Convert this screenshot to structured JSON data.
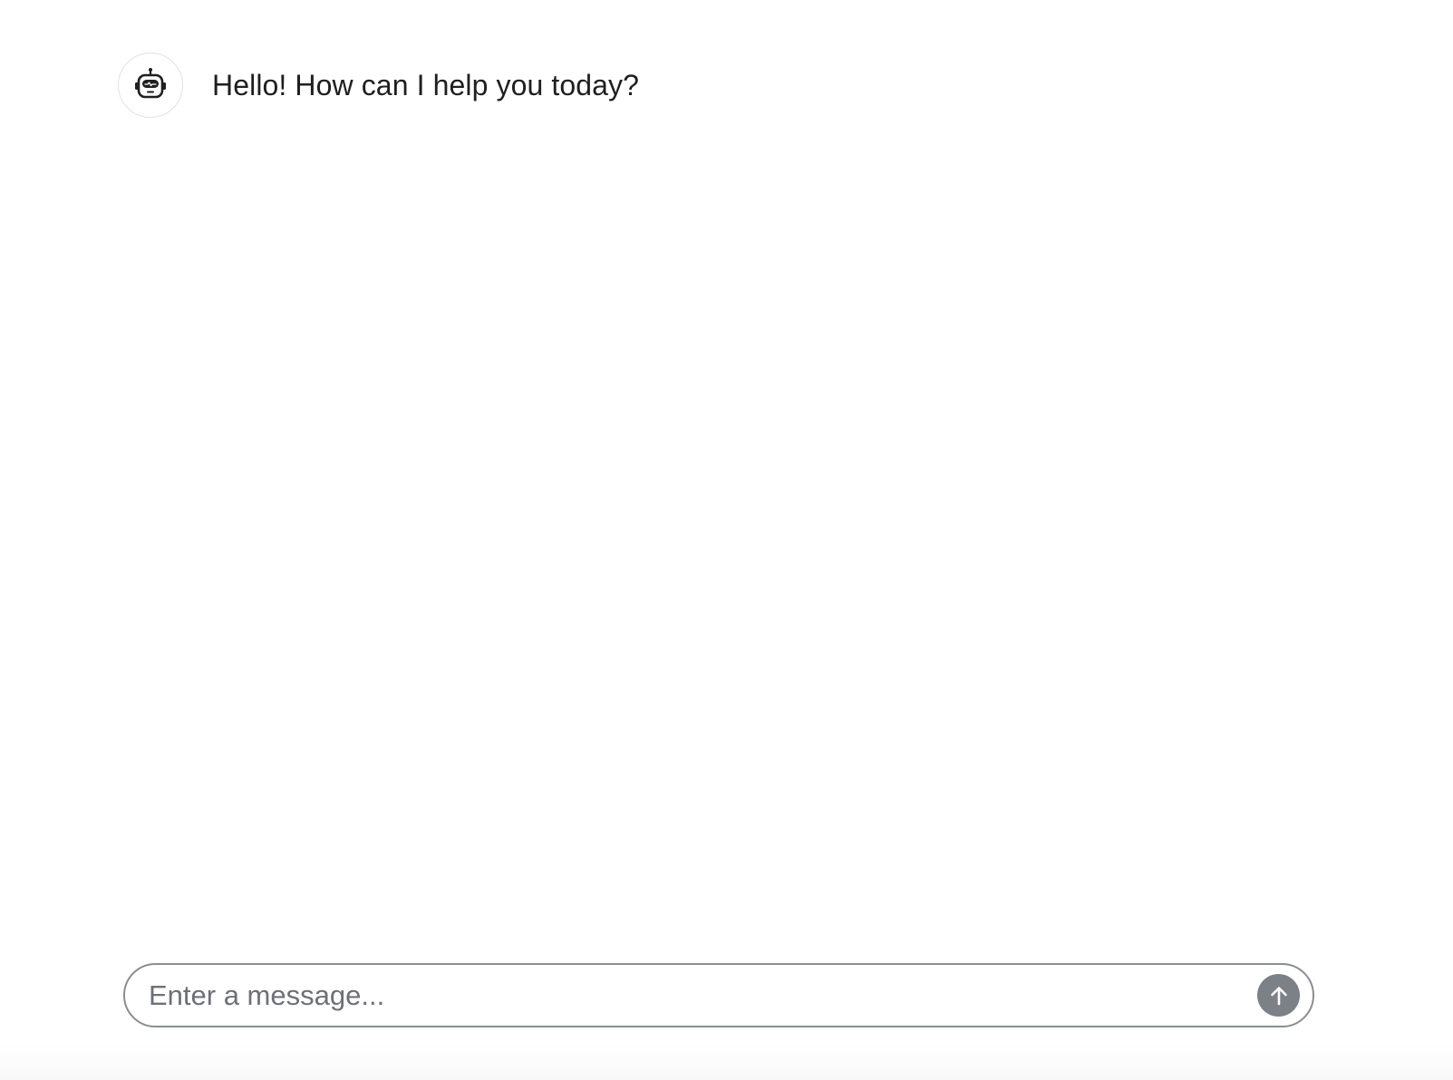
{
  "conversation": {
    "messages": [
      {
        "role": "assistant",
        "avatar_icon": "robot-icon",
        "text": "Hello! How can I help you today?"
      }
    ]
  },
  "composer": {
    "placeholder": "Enter a message...",
    "value": "",
    "send_icon": "arrow-up-icon",
    "send_button_color": "#7c8087",
    "border_color": "#8a8d93"
  }
}
